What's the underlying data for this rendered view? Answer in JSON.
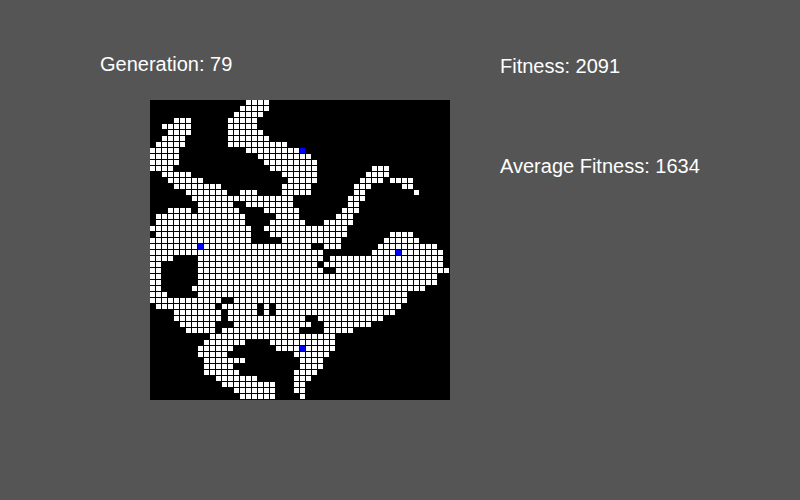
{
  "generation": {
    "label": "Generation: 79"
  },
  "stats": {
    "fitness": "Fitness: 2091",
    "average_fitness": "Average Fitness: 1634"
  },
  "grid": {
    "size": 50,
    "rows": [
      [
        [
          16,
          19
        ]
      ],
      [
        [
          15,
          19
        ]
      ],
      [
        [
          14,
          18
        ]
      ],
      [
        [
          4,
          6
        ],
        [
          13,
          17
        ]
      ],
      [
        [
          2,
          6
        ],
        [
          13,
          17
        ]
      ],
      [
        [
          3,
          6
        ],
        [
          13,
          18
        ]
      ],
      [
        [
          2,
          5
        ],
        [
          13,
          19
        ]
      ],
      [
        [
          1,
          5
        ],
        [
          13,
          22
        ]
      ],
      [
        [
          0,
          4
        ],
        [
          16,
          24
        ]
      ],
      [
        [
          0,
          4
        ],
        [
          18,
          26
        ]
      ],
      [
        [
          0,
          4
        ],
        [
          19,
          27
        ]
      ],
      [
        [
          0,
          3
        ],
        [
          20,
          27
        ],
        [
          37,
          39
        ]
      ],
      [
        [
          2,
          6
        ],
        [
          22,
          27
        ],
        [
          36,
          39
        ]
      ],
      [
        [
          3,
          8
        ],
        [
          23,
          27
        ],
        [
          35,
          38
        ],
        [
          40,
          43
        ]
      ],
      [
        [
          4,
          11
        ],
        [
          22,
          26
        ],
        [
          34,
          36
        ],
        [
          42,
          43
        ]
      ],
      [
        [
          6,
          12
        ],
        [
          15,
          17
        ],
        [
          22,
          26
        ],
        [
          34,
          35
        ],
        [
          44,
          44
        ]
      ],
      [
        [
          7,
          23
        ],
        [
          33,
          35
        ]
      ],
      [
        [
          8,
          13
        ],
        [
          16,
          23
        ],
        [
          33,
          34
        ]
      ],
      [
        [
          3,
          6
        ],
        [
          8,
          14
        ],
        [
          19,
          24
        ],
        [
          32,
          34
        ]
      ],
      [
        [
          1,
          15
        ],
        [
          21,
          24
        ],
        [
          31,
          33
        ]
      ],
      [
        [
          1,
          15
        ],
        [
          20,
          25
        ],
        [
          29,
          33
        ]
      ],
      [
        [
          0,
          16
        ],
        [
          19,
          32
        ]
      ],
      [
        [
          1,
          16
        ],
        [
          20,
          32
        ],
        [
          40,
          43
        ]
      ],
      [
        [
          0,
          16
        ],
        [
          22,
          31
        ],
        [
          39,
          44
        ]
      ],
      [
        [
          0,
          26
        ],
        [
          29,
          31
        ],
        [
          38,
          47
        ]
      ],
      [
        [
          0,
          28
        ],
        [
          37,
          48
        ]
      ],
      [
        [
          0,
          3
        ],
        [
          8,
          28
        ],
        [
          30,
          48
        ]
      ],
      [
        [
          0,
          1
        ],
        [
          8,
          27
        ],
        [
          29,
          48
        ]
      ],
      [
        [
          0,
          1
        ],
        [
          8,
          28
        ],
        [
          31,
          49
        ]
      ],
      [
        [
          0,
          1
        ],
        [
          8,
          47
        ]
      ],
      [
        [
          0,
          1
        ],
        [
          8,
          47
        ]
      ],
      [
        [
          0,
          1
        ],
        [
          7,
          45
        ]
      ],
      [
        [
          0,
          2
        ],
        [
          8,
          42
        ]
      ],
      [
        [
          0,
          11
        ],
        [
          14,
          42
        ]
      ],
      [
        [
          1,
          10
        ],
        [
          12,
          17
        ],
        [
          19,
          19
        ],
        [
          21,
          41
        ]
      ],
      [
        [
          4,
          11
        ],
        [
          13,
          17
        ],
        [
          19,
          19
        ],
        [
          21,
          40
        ]
      ],
      [
        [
          4,
          11
        ],
        [
          13,
          25
        ],
        [
          28,
          38
        ]
      ],
      [
        [
          5,
          10
        ],
        [
          14,
          26
        ],
        [
          29,
          36
        ]
      ],
      [
        [
          6,
          10
        ],
        [
          12,
          24
        ],
        [
          29,
          33
        ]
      ],
      [
        [
          10,
          30
        ]
      ],
      [
        [
          9,
          15
        ],
        [
          20,
          30
        ]
      ],
      [
        [
          8,
          13
        ],
        [
          21,
          30
        ]
      ],
      [
        [
          8,
          12
        ],
        [
          24,
          29
        ]
      ],
      [
        [
          9,
          15
        ],
        [
          25,
          28
        ]
      ],
      [
        [
          9,
          13
        ],
        [
          25,
          28
        ]
      ],
      [
        [
          9,
          14
        ],
        [
          24,
          27
        ]
      ],
      [
        [
          11,
          17
        ],
        [
          24,
          26
        ]
      ],
      [
        [
          12,
          20
        ],
        [
          24,
          25
        ]
      ],
      [
        [
          14,
          20
        ],
        [
          24,
          25
        ]
      ],
      [
        [
          15,
          20
        ],
        [
          25,
          25
        ]
      ]
    ],
    "markers": [
      {
        "row": 8,
        "col": 25
      },
      {
        "row": 24,
        "col": 8
      },
      {
        "row": 25,
        "col": 41
      },
      {
        "row": 41,
        "col": 25
      }
    ]
  }
}
